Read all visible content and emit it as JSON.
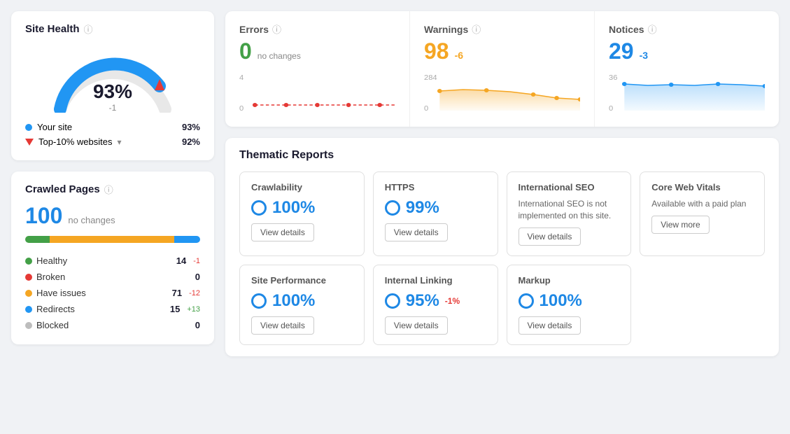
{
  "siteHealth": {
    "title": "Site Health",
    "percent": "93%",
    "change": "-1",
    "yourSite": {
      "label": "Your site",
      "value": "93%"
    },
    "topSites": {
      "label": "Top-10% websites",
      "value": "92%"
    }
  },
  "crawledPages": {
    "title": "Crawled Pages",
    "count": "100",
    "note": "no changes",
    "healthy": {
      "label": "Healthy",
      "count": "14",
      "change": "-1",
      "changeType": "neg",
      "pct": 14
    },
    "broken": {
      "label": "Broken",
      "count": "0",
      "change": "",
      "changeType": "",
      "pct": 0
    },
    "haveIssues": {
      "label": "Have issues",
      "count": "71",
      "change": "-12",
      "changeType": "neg",
      "pct": 71
    },
    "redirects": {
      "label": "Redirects",
      "count": "15",
      "change": "+13",
      "changeType": "pos",
      "pct": 15
    },
    "blocked": {
      "label": "Blocked",
      "count": "0",
      "change": "",
      "changeType": "",
      "pct": 0
    }
  },
  "metrics": {
    "errors": {
      "title": "Errors",
      "value": "0",
      "valueClass": "green",
      "note": "no changes",
      "chartMin": "0",
      "chartMax": "4"
    },
    "warnings": {
      "title": "Warnings",
      "value": "98",
      "valueClass": "orange",
      "change": "-6",
      "changeClass": "orange",
      "chartMin": "0",
      "chartMax": "284"
    },
    "notices": {
      "title": "Notices",
      "value": "29",
      "valueClass": "blue",
      "change": "-3",
      "changeClass": "blue",
      "chartMin": "0",
      "chartMax": "36"
    }
  },
  "thematicReports": {
    "title": "Thematic Reports",
    "items": [
      {
        "name": "Crawlability",
        "score": "100%",
        "hasScore": true,
        "desc": "",
        "btnLabel": "View details",
        "btnType": "details"
      },
      {
        "name": "HTTPS",
        "score": "99%",
        "hasScore": true,
        "desc": "",
        "btnLabel": "View details",
        "btnType": "details"
      },
      {
        "name": "International SEO",
        "score": "",
        "hasScore": false,
        "desc": "International SEO is not implemented on this site.",
        "btnLabel": "View details",
        "btnType": "details"
      },
      {
        "name": "Core Web Vitals",
        "score": "",
        "hasScore": false,
        "desc": "Available with a paid plan",
        "btnLabel": "View more",
        "btnType": "more"
      }
    ],
    "items2": [
      {
        "name": "Site Performance",
        "score": "100%",
        "hasScore": true,
        "scoreChange": "",
        "desc": "",
        "btnLabel": "View details",
        "btnType": "details"
      },
      {
        "name": "Internal Linking",
        "score": "95%",
        "hasScore": true,
        "scoreChange": "-1%",
        "desc": "",
        "btnLabel": "View details",
        "btnType": "details"
      },
      {
        "name": "Markup",
        "score": "100%",
        "hasScore": true,
        "scoreChange": "",
        "desc": "",
        "btnLabel": "View details",
        "btnType": "details"
      }
    ]
  }
}
